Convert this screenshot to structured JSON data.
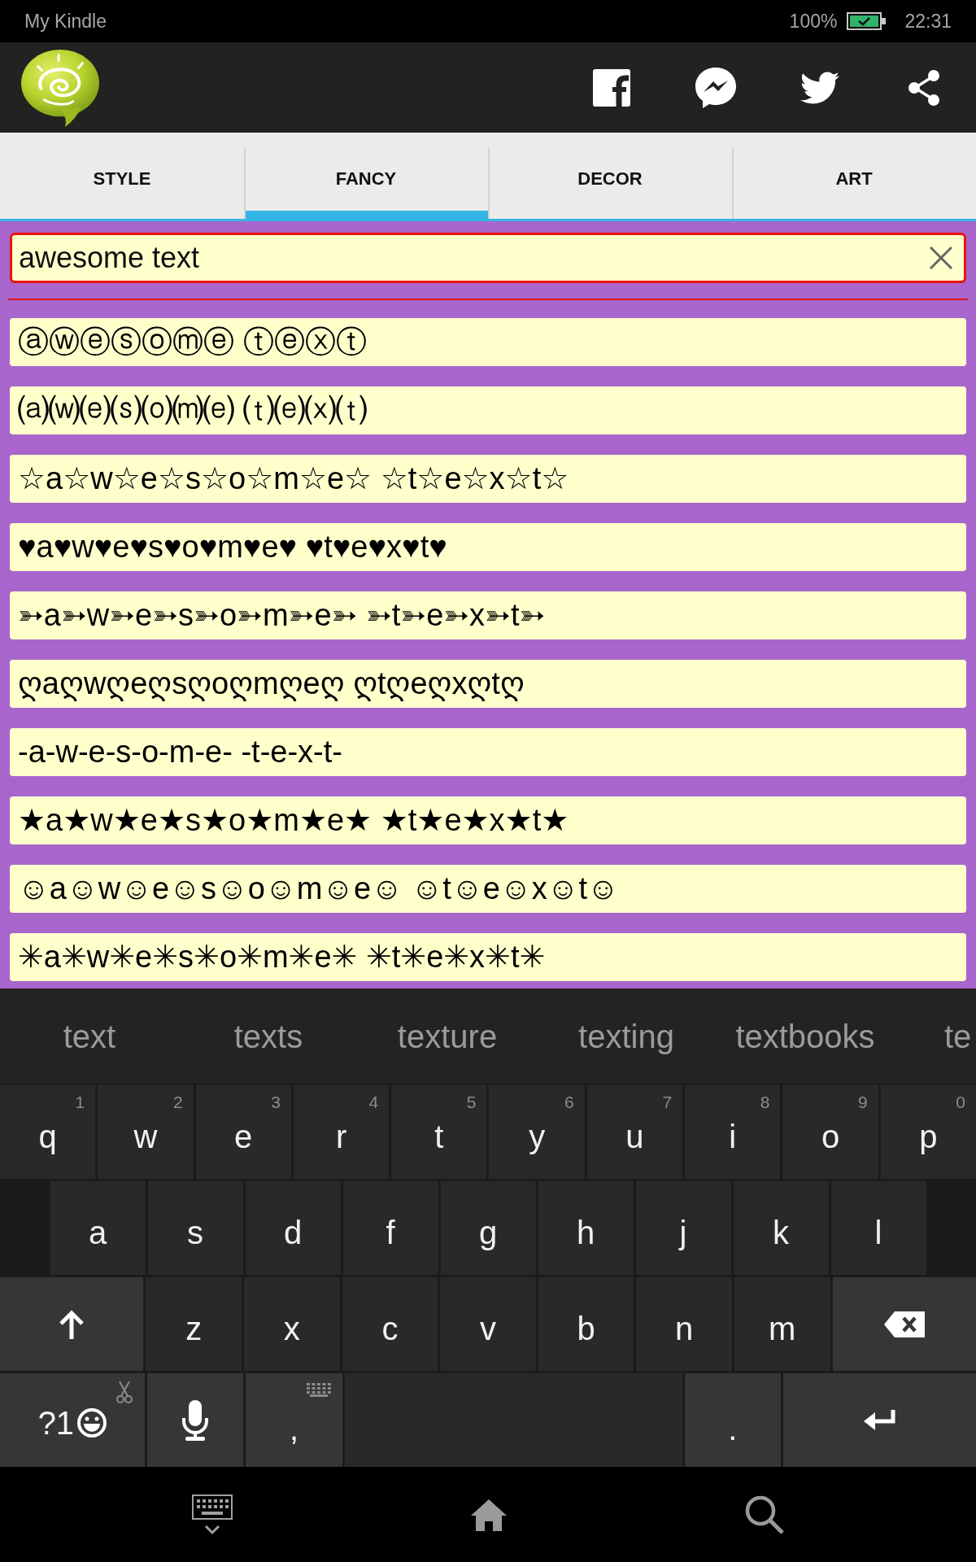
{
  "status_bar": {
    "device": "My Kindle",
    "battery": "100%",
    "time": "22:31"
  },
  "tabs": [
    {
      "label": "STYLE",
      "selected": false
    },
    {
      "label": "FANCY",
      "selected": true
    },
    {
      "label": "DECOR",
      "selected": false
    },
    {
      "label": "ART",
      "selected": false
    }
  ],
  "input": {
    "value": "awesome text"
  },
  "results": [
    "ⓐⓦⓔⓢⓞⓜⓔ ⓣⓔⓧⓣ",
    "⒜⒲⒠⒮⒪⒨⒠ ⒯⒠⒳⒯",
    "☆a☆w☆e☆s☆o☆m☆e☆ ☆t☆e☆x☆t☆",
    "♥a♥w♥e♥s♥o♥m♥e♥ ♥t♥e♥x♥t♥",
    "➳a➳w➳e➳s➳o➳m➳e➳ ➳t➳e➳x➳t➳",
    "ღaღwღeღsღoღmღeღ ღtღeღxღtღ",
    "-a-w-e-s-o-m-e- -t-e-x-t-",
    "★a★w★e★s★o★m★e★ ★t★e★x★t★",
    "☺a☺w☺e☺s☺o☺m☺e☺ ☺t☺e☺x☺t☺",
    "✳a✳w✳e✳s✳o✳m✳e✳ ✳t✳e✳x✳t✳"
  ],
  "keyboard": {
    "suggestions": [
      "text",
      "texts",
      "texture",
      "texting",
      "textbooks",
      "te"
    ],
    "rows": [
      [
        {
          "kind": "letter",
          "label": "q",
          "hint": "1"
        },
        {
          "kind": "letter",
          "label": "w",
          "hint": "2"
        },
        {
          "kind": "letter",
          "label": "e",
          "hint": "3"
        },
        {
          "kind": "letter",
          "label": "r",
          "hint": "4"
        },
        {
          "kind": "letter",
          "label": "t",
          "hint": "5"
        },
        {
          "kind": "letter",
          "label": "y",
          "hint": "6"
        },
        {
          "kind": "letter",
          "label": "u",
          "hint": "7"
        },
        {
          "kind": "letter",
          "label": "i",
          "hint": "8"
        },
        {
          "kind": "letter",
          "label": "o",
          "hint": "9"
        },
        {
          "kind": "letter",
          "label": "p",
          "hint": "0"
        }
      ],
      [
        {
          "kind": "letter",
          "label": "a"
        },
        {
          "kind": "letter",
          "label": "s"
        },
        {
          "kind": "letter",
          "label": "d"
        },
        {
          "kind": "letter",
          "label": "f"
        },
        {
          "kind": "letter",
          "label": "g"
        },
        {
          "kind": "letter",
          "label": "h"
        },
        {
          "kind": "letter",
          "label": "j"
        },
        {
          "kind": "letter",
          "label": "k"
        },
        {
          "kind": "letter",
          "label": "l"
        }
      ],
      [
        {
          "kind": "shift"
        },
        {
          "kind": "letter",
          "label": "z"
        },
        {
          "kind": "letter",
          "label": "x"
        },
        {
          "kind": "letter",
          "label": "c"
        },
        {
          "kind": "letter",
          "label": "v"
        },
        {
          "kind": "letter",
          "label": "b"
        },
        {
          "kind": "letter",
          "label": "n"
        },
        {
          "kind": "letter",
          "label": "m"
        },
        {
          "kind": "backspace"
        }
      ],
      [
        {
          "kind": "symbols",
          "label": "?1"
        },
        {
          "kind": "mic"
        },
        {
          "kind": "comma",
          "label": ","
        },
        {
          "kind": "space"
        },
        {
          "kind": "period",
          "label": "."
        },
        {
          "kind": "enter"
        }
      ]
    ]
  }
}
